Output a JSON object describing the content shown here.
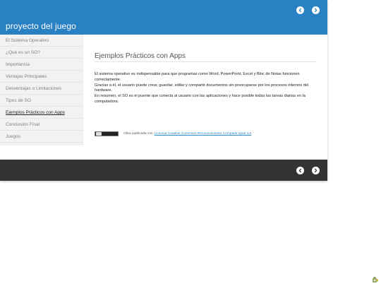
{
  "header": {
    "site_title": "proyecto del juego",
    "background": "#2980c2"
  },
  "navigation": {
    "prev_icon": "chevron-left-icon",
    "next_icon": "chevron-right-icon"
  },
  "sidebar": {
    "items": [
      {
        "label": "El Sistema Operativo",
        "active": false
      },
      {
        "label": "¿Qué es un SO?",
        "active": false
      },
      {
        "label": "Importancia",
        "active": false
      },
      {
        "label": "Ventajas Principales",
        "active": false
      },
      {
        "label": "Desventajas o Limitaciones",
        "active": false
      },
      {
        "label": "Tipos de SO",
        "active": false
      },
      {
        "label": "Ejemplos Prácticos con Apps",
        "active": true
      },
      {
        "label": "Conclusión Final",
        "active": false
      },
      {
        "label": "Juegos",
        "active": false
      }
    ]
  },
  "main": {
    "title": "Ejemplos Prácticos con Apps",
    "paragraphs": [
      "El sistema operativo es indispensable para que programas como Word, PowerPoint, Excel y Bloc de Notas funcionen correctamente.",
      "Gracias a él, el usuario puede crear, guardar, editar y compartir documentos sin preocuparse por los procesos internos del hardware.",
      "En resumen, el SO es el puente que conecta al usuario con las aplicaciones y hace posible todas las tareas diarias en la computadora."
    ],
    "license": {
      "badge_icon": "creative-commons-badge",
      "text": "Obra publicada con",
      "link_text": "Licencia Creative Commons Reconocimiento Compartir igual 4.0"
    }
  },
  "footer": {
    "background": "#333333"
  },
  "corner_widget": {
    "icon": "puzzle-icon"
  }
}
